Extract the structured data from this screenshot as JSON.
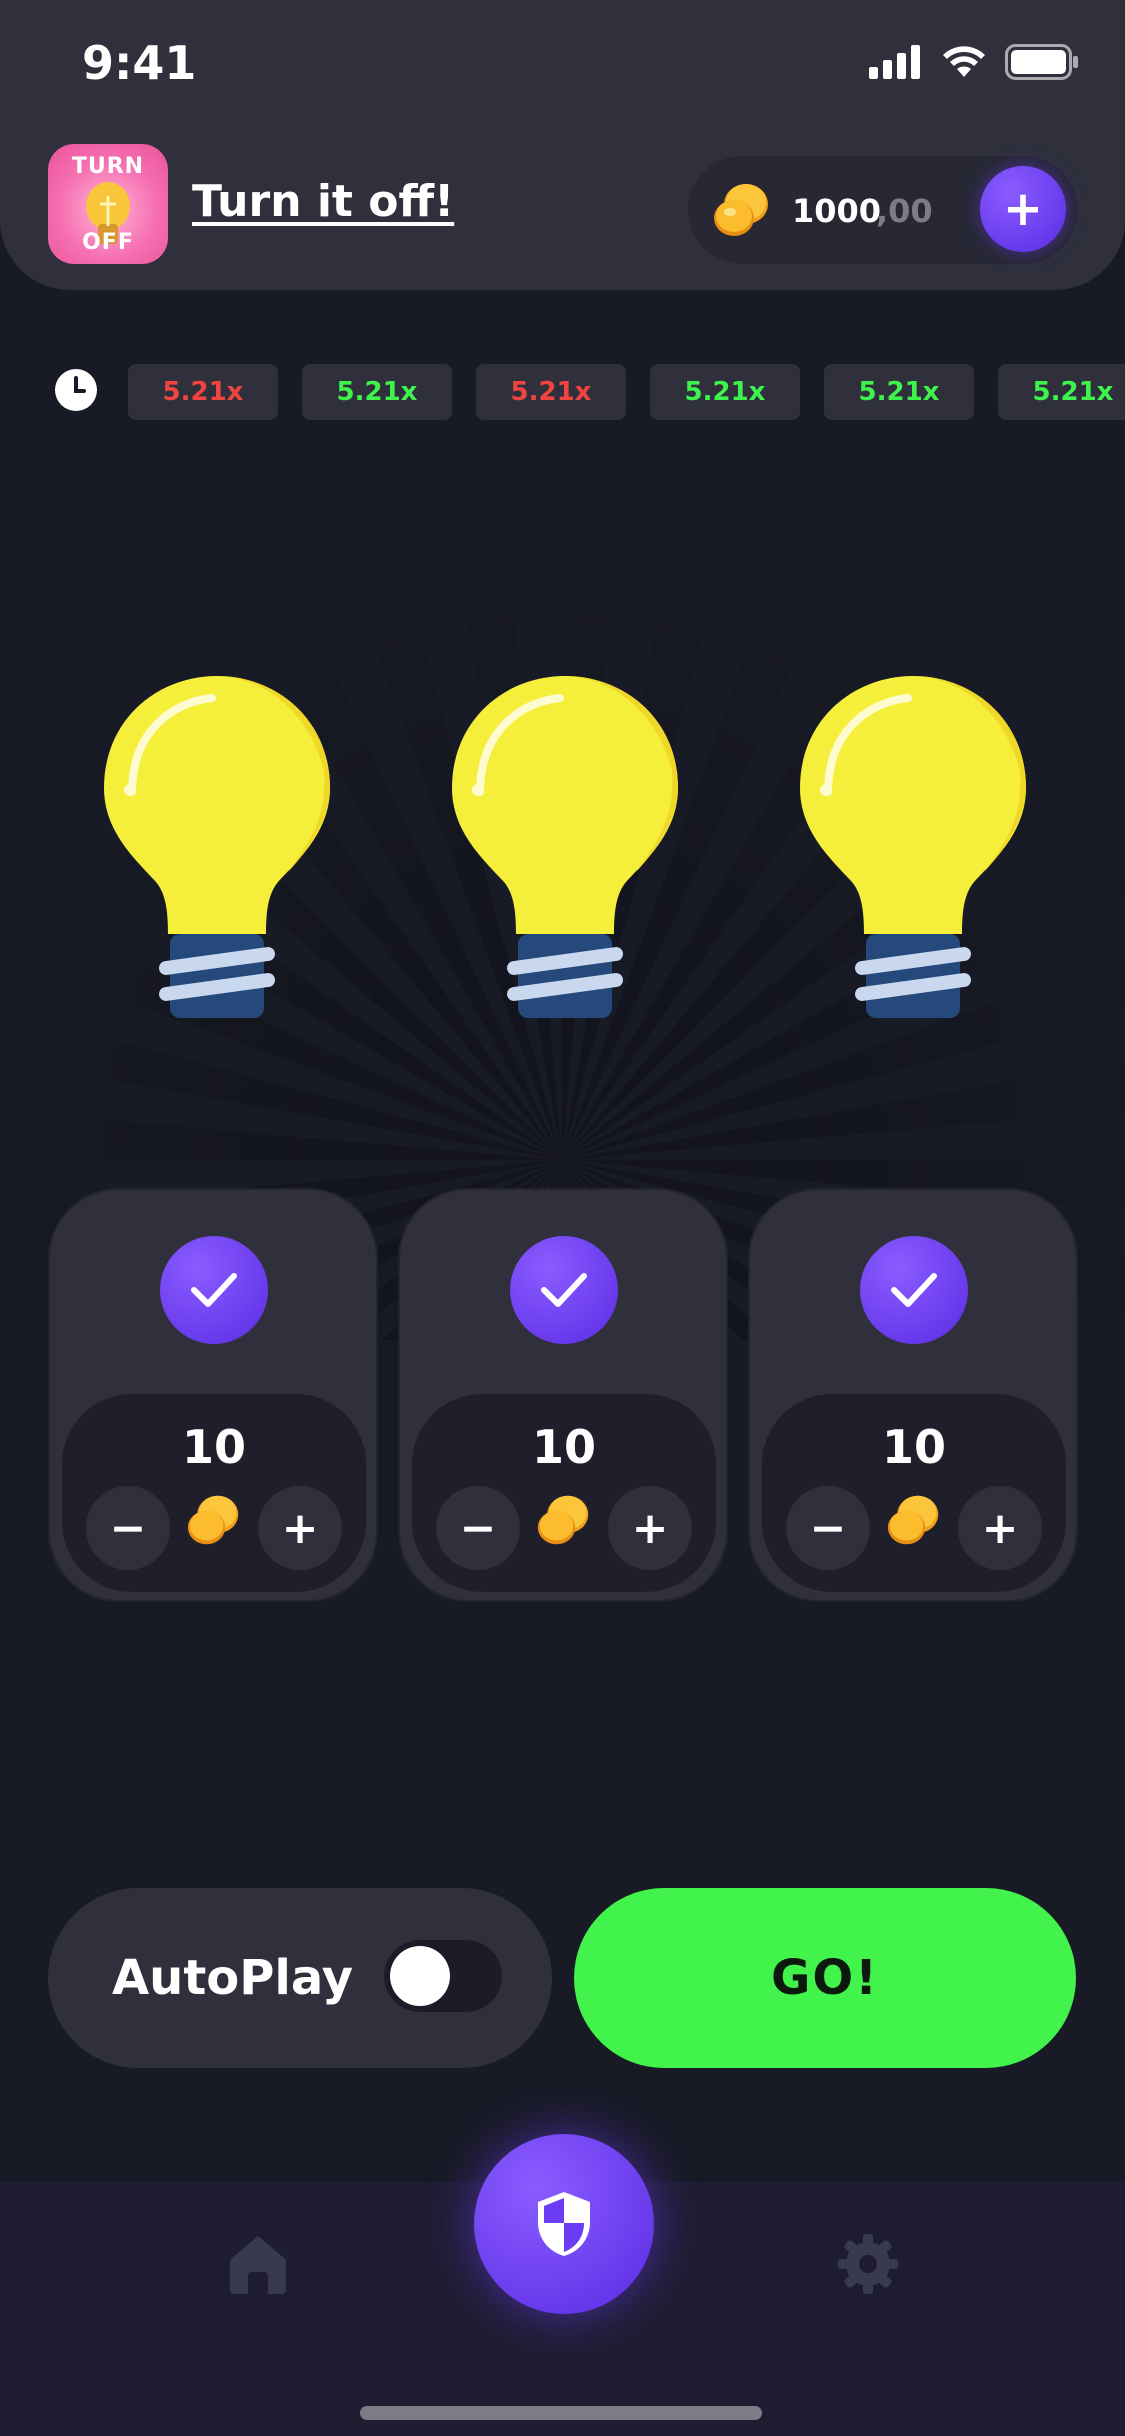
{
  "status_bar": {
    "time": "9:41"
  },
  "header": {
    "icon_text_top": "TURN",
    "icon_text_bottom": "OFF",
    "title": "Turn it off!",
    "balance_whole": "1000",
    "balance_decimal": ",00",
    "add_label": "+"
  },
  "history": [
    {
      "value": "5.21x",
      "color": "#f2443f"
    },
    {
      "value": "5.21x",
      "color": "#3ef44c"
    },
    {
      "value": "5.21x",
      "color": "#f2443f"
    },
    {
      "value": "5.21x",
      "color": "#3ef44c"
    },
    {
      "value": "5.21x",
      "color": "#3ef44c"
    },
    {
      "value": "5.21x",
      "color": "#3ef44c"
    }
  ],
  "cards": [
    {
      "stake": "10",
      "minus": "−",
      "plus": "+"
    },
    {
      "stake": "10",
      "minus": "−",
      "plus": "+"
    },
    {
      "stake": "10",
      "minus": "−",
      "plus": "+"
    }
  ],
  "controls": {
    "autoplay_label": "AutoPlay",
    "autoplay_on": false,
    "go_label": "GO!"
  },
  "tabbar": {
    "left_icon": "home-icon",
    "center_icon": "shield-icon",
    "right_icon": "gear-icon"
  },
  "colors": {
    "accent": "#6a3cf5",
    "go": "#41f34b",
    "loss": "#f2443f",
    "win": "#3ef44c",
    "bulb": "#f5ef3c"
  }
}
